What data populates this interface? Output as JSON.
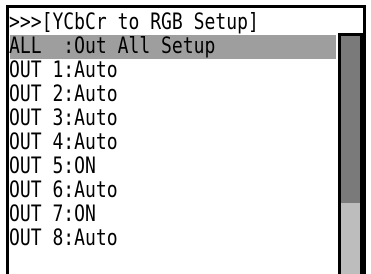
{
  "menu": {
    "title": ">>>[YCbCr to RGB Setup]",
    "items": [
      {
        "label": "ALL  :Out All Setup"
      },
      {
        "label": "OUT 1:Auto"
      },
      {
        "label": "OUT 2:Auto"
      },
      {
        "label": "OUT 3:Auto"
      },
      {
        "label": "OUT 4:Auto"
      },
      {
        "label": "OUT 5:ON"
      },
      {
        "label": "OUT 6:Auto"
      },
      {
        "label": "OUT 7:ON"
      },
      {
        "label": "OUT 8:Auto"
      }
    ],
    "selected_index": 0,
    "scroll_position_fraction": 0.0,
    "scroll_visible_fraction": 0.7
  },
  "colors": {
    "text": "#000000",
    "background": "#ffffff",
    "selection": "#9e9e9e",
    "scroll_track": "#bdbdbd",
    "scroll_thumb": "#7a7a7a"
  }
}
